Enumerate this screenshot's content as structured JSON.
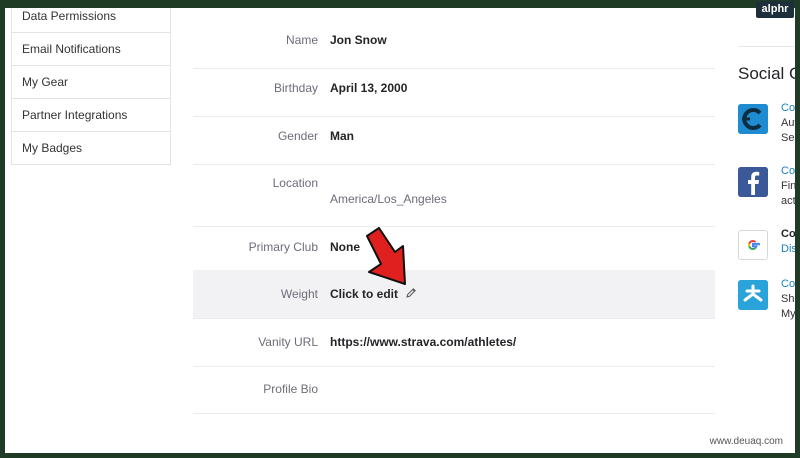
{
  "brand_badge": "alphr",
  "watermark": "www.deuaq.com",
  "sidebar": {
    "items": [
      {
        "label": "Data Permissions"
      },
      {
        "label": "Email Notifications"
      },
      {
        "label": "My Gear"
      },
      {
        "label": "Partner Integrations"
      },
      {
        "label": "My Badges"
      }
    ]
  },
  "profile": {
    "name_label": "Name",
    "name_value": "Jon Snow",
    "birthday_label": "Birthday",
    "birthday_value": "April 13, 2000",
    "gender_label": "Gender",
    "gender_value": "Man",
    "location_label": "Location",
    "location_value": "America/Los_Angeles",
    "club_label": "Primary Club",
    "club_value": "None",
    "weight_label": "Weight",
    "weight_value": "Click to edit",
    "vanity_label": "Vanity URL",
    "vanity_value": "https://www.strava.com/athletes/",
    "bio_label": "Profile Bio",
    "bio_value": ""
  },
  "social": {
    "title": "Social C",
    "items": [
      {
        "icon": "cycling-app-icon",
        "lines": [
          "Co",
          "Aut",
          "Seg"
        ]
      },
      {
        "icon": "facebook-icon",
        "lines": [
          "Co",
          "Fin",
          "acti"
        ]
      },
      {
        "icon": "google-icon",
        "lines": [
          "Con",
          "Dis"
        ]
      },
      {
        "icon": "sharing-app-icon",
        "lines": [
          "Co",
          "Sha",
          "My"
        ]
      }
    ]
  },
  "colors": {
    "accent": "#1a80c3",
    "frame": "#1f3a25",
    "arrow": "#e0201f"
  }
}
